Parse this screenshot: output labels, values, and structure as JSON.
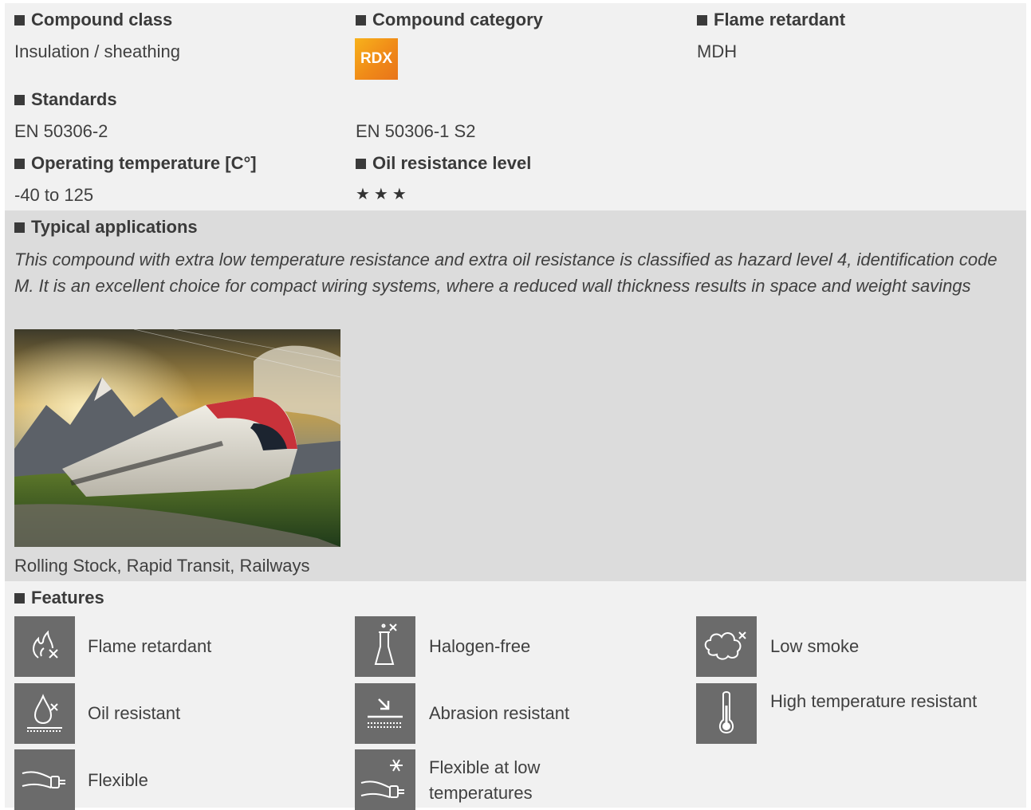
{
  "compound_class": {
    "heading": "Compound class",
    "value": "Insulation / sheathing"
  },
  "compound_category": {
    "heading": "Compound category",
    "badge": "RDX"
  },
  "flame_retardant": {
    "heading": "Flame retardant",
    "value": "MDH"
  },
  "standards": {
    "heading": "Standards",
    "values": [
      "EN 50306-2",
      "EN 50306-1 S2"
    ]
  },
  "operating_temperature": {
    "heading": "Operating temperature [C°]",
    "value": "-40 to 125"
  },
  "oil_resistance": {
    "heading": "Oil resistance level",
    "stars": "★★★",
    "level": 3
  },
  "typical_applications": {
    "heading": "Typical applications",
    "description": "This compound with extra low temperature resistance and extra oil resistance is classified as hazard level 4, identification code M. It is an excellent choice for compact wiring systems, where a reduced wall thickness results in space and weight savings",
    "image_caption": "Rolling Stock, Rapid Transit, Railways"
  },
  "features": {
    "heading": "Features",
    "items": [
      {
        "label": "Flame retardant",
        "icon": "flame-cross-icon"
      },
      {
        "label": "Halogen-free",
        "icon": "flask-cross-icon"
      },
      {
        "label": "Low smoke",
        "icon": "cloud-cross-icon"
      },
      {
        "label": "Oil resistant",
        "icon": "drop-cross-icon"
      },
      {
        "label": "Abrasion resistant",
        "icon": "abrasion-arrow-icon"
      },
      {
        "label": "High temperature resistant",
        "icon": "thermometer-icon"
      },
      {
        "label": "Flexible",
        "icon": "bent-cable-icon"
      },
      {
        "label": "Flexible at low temperatures",
        "icon": "snowflake-cable-icon"
      }
    ]
  },
  "colors": {
    "light_band": "#f1f1f1",
    "dark_band": "#dcdcdc",
    "icon_bg": "#6b6b6b",
    "badge_orange": "#f08a18"
  }
}
